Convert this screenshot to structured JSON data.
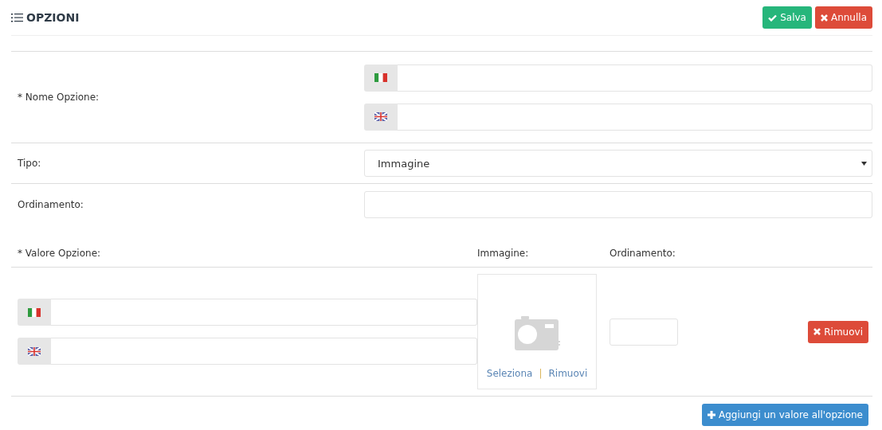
{
  "header": {
    "title": "OPZIONI",
    "buttons": [
      {
        "label": "Salva",
        "kind": "save"
      },
      {
        "label": "Annulla",
        "kind": "cancel"
      }
    ]
  },
  "form": {
    "name_label": "* Nome Opzione:",
    "name_fields": [
      {
        "kind": "italian"
      },
      {
        "kind": "english"
      }
    ],
    "type_label": "Tipo:",
    "type_value": "Immagine",
    "order_label": "Ordinamento:"
  },
  "values": {
    "columns": [
      "* Valore Opzione:",
      "Immagine:",
      "Ordinamento:"
    ],
    "rows": [
      {
        "fields": [
          {
            "kind": "italian"
          },
          {
            "kind": "english"
          }
        ],
        "image_links": [
          "Seleziona",
          "|",
          "Rimuovi"
        ],
        "remove": "Rimuovi"
      }
    ],
    "add_button": "Aggiungi un valore all'opzione"
  }
}
